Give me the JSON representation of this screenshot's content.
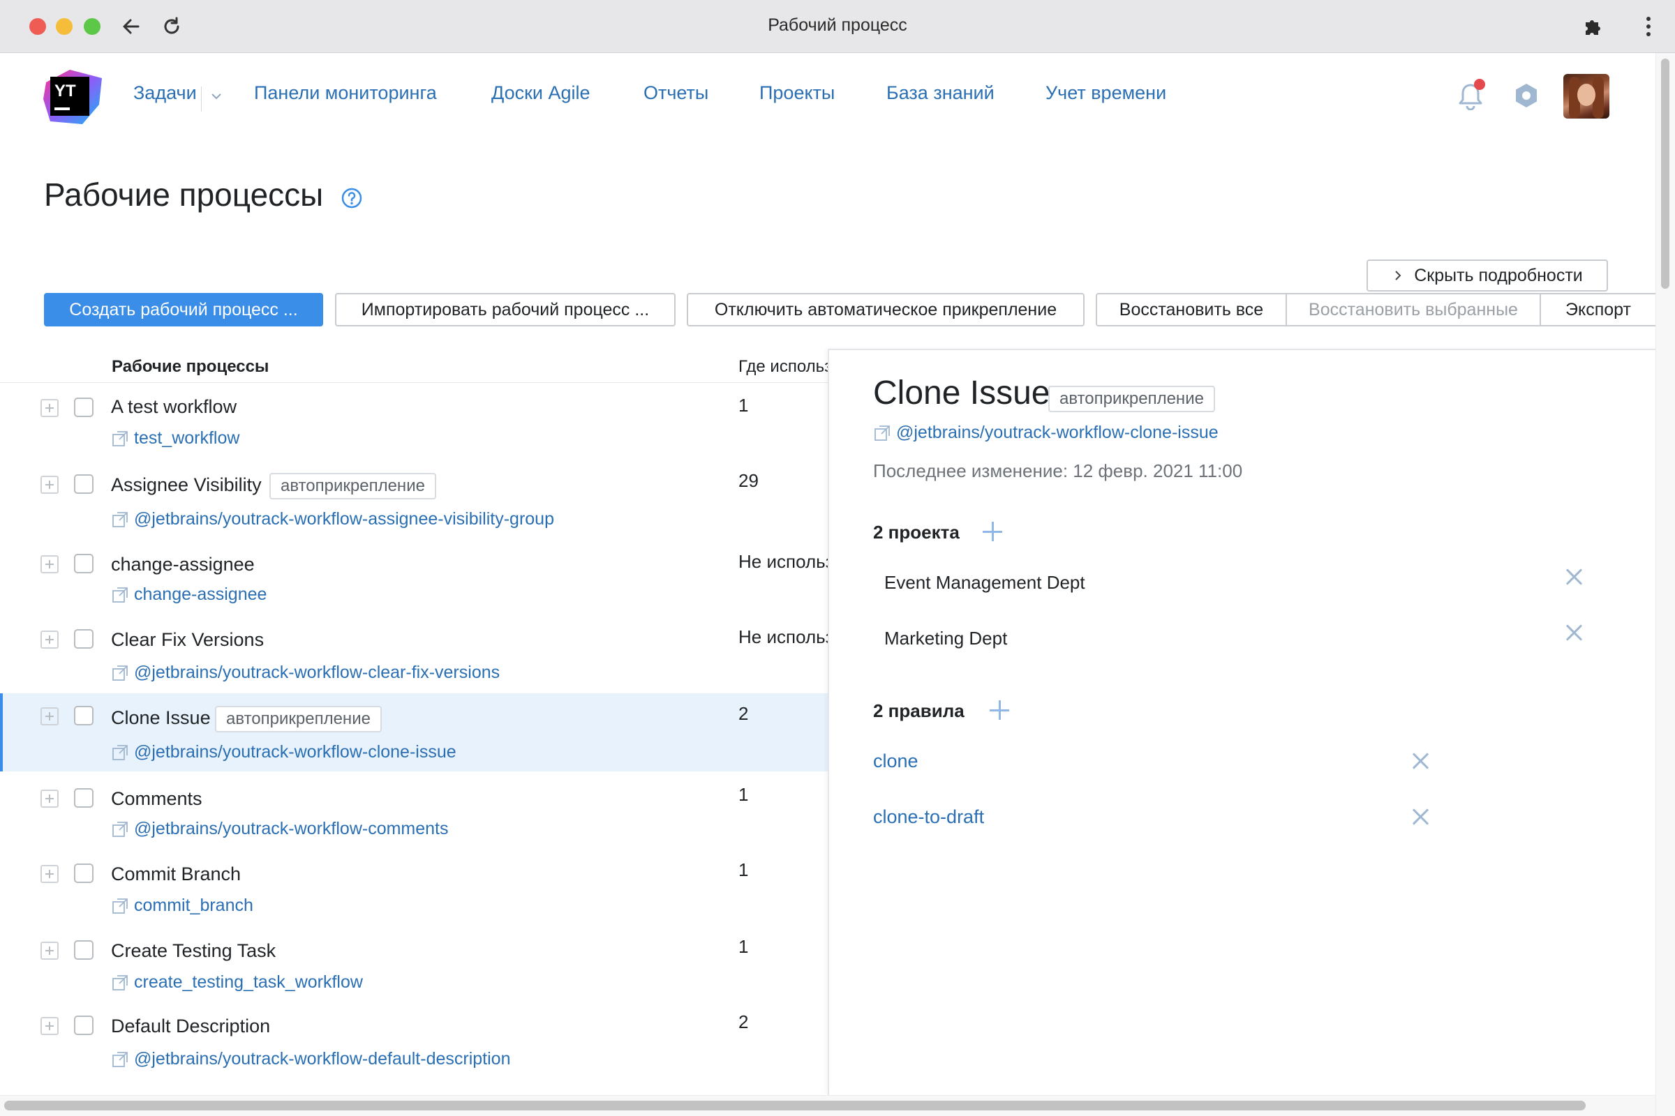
{
  "window": {
    "title": "Рабочий процесс"
  },
  "nav": {
    "items": [
      "Задачи",
      "Панели мониторинга",
      "Доски Agile",
      "Отчеты",
      "Проекты",
      "База знаний",
      "Учет времени"
    ],
    "logo_text": "YT"
  },
  "page": {
    "title": "Рабочие процессы"
  },
  "toolbar": {
    "create": "Создать рабочий процесс ...",
    "import": "Импортировать рабочий процесс ...",
    "disable_auto": "Отключить автоматическое прикрепление",
    "restore_all": "Восстановить все",
    "restore_selected": "Восстановить выбранные",
    "export": "Экспорт",
    "hide_details": "Скрыть подробности"
  },
  "table": {
    "headers": {
      "workflows": "Рабочие процессы",
      "where_used": "Где использ"
    },
    "rows": [
      {
        "name": "A test workflow",
        "badge": "",
        "package": "test_workflow",
        "where": "1"
      },
      {
        "name": "Assignee Visibility",
        "badge": "автоприкрепление",
        "package": "@jetbrains/youtrack-workflow-assignee-visibility-group",
        "where": "29"
      },
      {
        "name": "change-assignee",
        "badge": "",
        "package": "change-assignee",
        "where": "Не использ"
      },
      {
        "name": "Clear Fix Versions",
        "badge": "",
        "package": "@jetbrains/youtrack-workflow-clear-fix-versions",
        "where": "Не использ"
      },
      {
        "name": "Clone Issue",
        "badge": "автоприкрепление",
        "package": "@jetbrains/youtrack-workflow-clone-issue",
        "where": "2",
        "selected": true
      },
      {
        "name": "Comments",
        "badge": "",
        "package": "@jetbrains/youtrack-workflow-comments",
        "where": "1"
      },
      {
        "name": "Commit Branch",
        "badge": "",
        "package": "commit_branch",
        "where": "1"
      },
      {
        "name": "Create Testing Task",
        "badge": "",
        "package": "create_testing_task_workflow",
        "where": "1"
      },
      {
        "name": "Default Description",
        "badge": "",
        "package": "@jetbrains/youtrack-workflow-default-description",
        "where": "2"
      }
    ]
  },
  "details": {
    "title": "Clone Issue",
    "badge": "автоприкрепление",
    "package": "@jetbrains/youtrack-workflow-clone-issue",
    "modified": "Последнее изменение: 12 февр. 2021 11:00",
    "projects_label": "2 проекта",
    "projects": [
      "Event Management Dept",
      "Marketing Dept"
    ],
    "rules_label": "2 правила",
    "rules": [
      "clone",
      "clone-to-draft"
    ]
  },
  "colors": {
    "accent": "#3a8ee8",
    "link": "#2a6fb3",
    "selected_row": "#e8f2fc"
  },
  "icons": [
    "back-arrow-icon",
    "reload-icon",
    "extensions-puzzle-icon",
    "more-vertical-icon",
    "bell-icon",
    "settings-hexagon-icon",
    "help-circle-icon",
    "package-link-icon",
    "expand-plus-icon",
    "chevron-right-icon",
    "close-x-icon",
    "add-plus-icon"
  ]
}
